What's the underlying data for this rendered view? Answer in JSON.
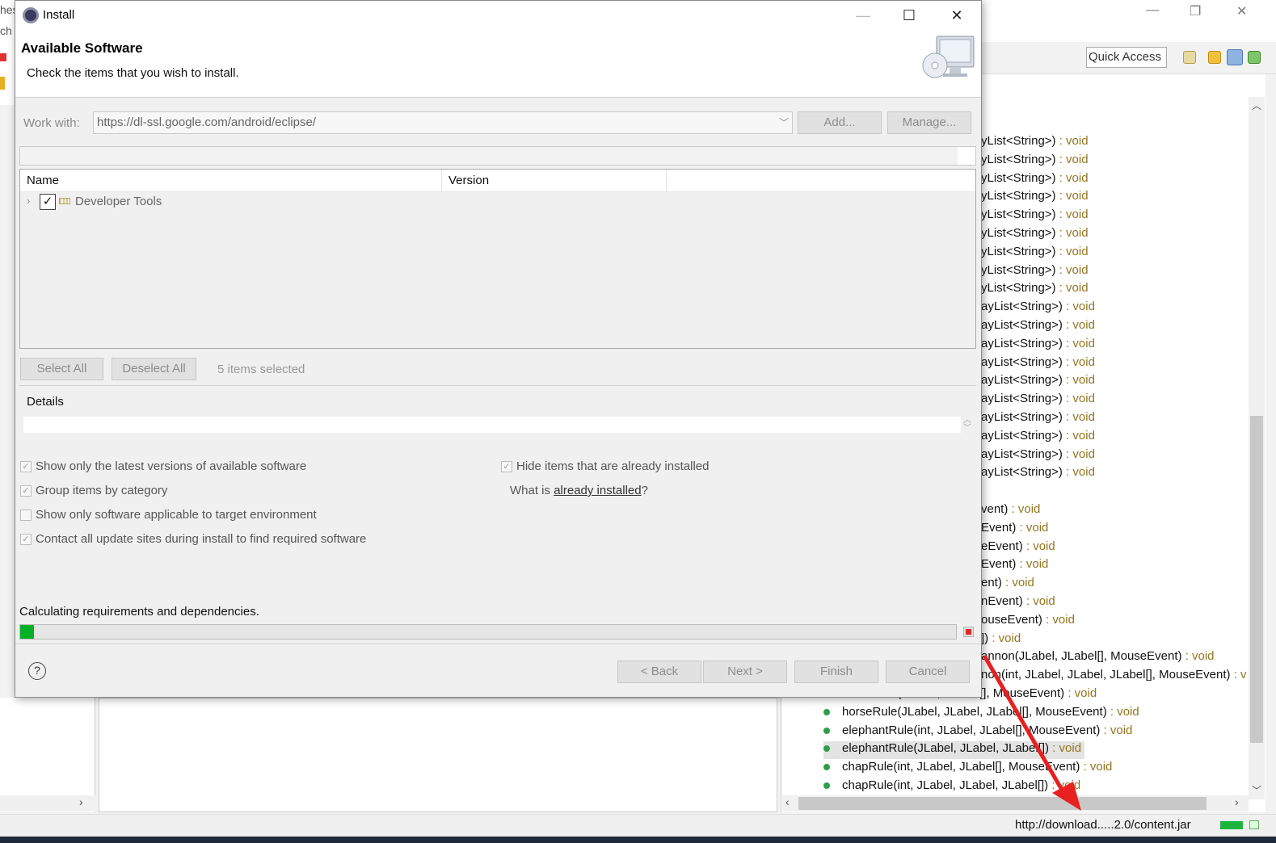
{
  "background": {
    "left_fragments": [
      "hes",
      "ch"
    ],
    "quick_access": "Quick Access",
    "outline_rows": [
      {
        "name": "yList<String>)",
        "ret": " : void"
      },
      {
        "name": "yList<String>)",
        "ret": " : void"
      },
      {
        "name": "yList<String>)",
        "ret": " : void"
      },
      {
        "name": "yList<String>)",
        "ret": " : void"
      },
      {
        "name": "yList<String>)",
        "ret": " : void"
      },
      {
        "name": "yList<String>)",
        "ret": " : void"
      },
      {
        "name": "yList<String>)",
        "ret": " : void"
      },
      {
        "name": "yList<String>)",
        "ret": " : void"
      },
      {
        "name": "yList<String>)",
        "ret": " : void"
      },
      {
        "name": "ayList<String>)",
        "ret": " : void"
      },
      {
        "name": "ayList<String>)",
        "ret": " : void"
      },
      {
        "name": "ayList<String>)",
        "ret": " : void"
      },
      {
        "name": "ayList<String>)",
        "ret": " : void"
      },
      {
        "name": "ayList<String>)",
        "ret": " : void"
      },
      {
        "name": "ayList<String>)",
        "ret": " : void"
      },
      {
        "name": "ayList<String>)",
        "ret": " : void"
      },
      {
        "name": "ayList<String>)",
        "ret": " : void"
      },
      {
        "name": "ayList<String>)",
        "ret": " : void"
      },
      {
        "name": "ayList<String>)",
        "ret": " : void"
      },
      {
        "name": "",
        "ret": ""
      },
      {
        "name": "vent)",
        "ret": " : void"
      },
      {
        "name": "Event)",
        "ret": " : void"
      },
      {
        "name": "eEvent)",
        "ret": " : void"
      },
      {
        "name": "Event)",
        "ret": " : void"
      },
      {
        "name": "ent)",
        "ret": " : void"
      },
      {
        "name": "nEvent)",
        "ret": " : void"
      },
      {
        "name": "ouseEvent)",
        "ret": " : void"
      },
      {
        "name": "])",
        "ret": " : void"
      },
      {
        "name": "annon(JLabel, JLabel[], MouseEvent)",
        "ret": " : void"
      },
      {
        "name": "non(int, JLabel, JLabel, JLabel[], MouseEvent)",
        "ret": " : v"
      },
      {
        "name": "horseRule(JLabel, JLabel[], MouseEvent)",
        "ret": " : void"
      },
      {
        "name": "horseRule(JLabel, JLabel, JLabel[], MouseEvent)",
        "ret": " : void"
      },
      {
        "name": "elephantRule(int, JLabel, JLabel[], MouseEvent)",
        "ret": " : void"
      },
      {
        "name": "elephantRule(JLabel, JLabel, JLabel[])",
        "ret": " : void"
      },
      {
        "name": "chapRule(int, JLabel, JLabel[], MouseEvent)",
        "ret": " : void"
      },
      {
        "name": "chapRule(int, JLabel, JLabel, JLabel[])",
        "ret": " : void"
      }
    ],
    "status_url": "http://download.....2.0/content.jar"
  },
  "dialog": {
    "title": "Install",
    "header_title": "Available Software",
    "header_desc": "Check the items that you wish to install.",
    "work_with_label": "Work with:",
    "work_with_value": "https://dl-ssl.google.com/android/eclipse/",
    "add_button": "Add...",
    "manage_button": "Manage...",
    "columns": [
      "Name",
      "Version"
    ],
    "tree_item": {
      "label": "Developer Tools",
      "checked": true
    },
    "select_all": "Select All",
    "deselect_all": "Deselect All",
    "selection_count": "5 items selected",
    "details_label": "Details",
    "options": {
      "latest_versions": {
        "label": "Show only the latest versions of available software",
        "checked": true
      },
      "group_by_category": {
        "label": "Group items by category",
        "checked": true
      },
      "target_env": {
        "label": "Show only software applicable to target environment",
        "checked": false
      },
      "contact_sites": {
        "label": "Contact all update sites during install to find required software",
        "checked": true
      },
      "hide_installed": {
        "label": "Hide items that are already installed",
        "checked": true
      }
    },
    "already_prefix": "What is ",
    "already_link": "already installed",
    "already_suffix": "?",
    "status_text": "Calculating requirements and dependencies.",
    "progress_fraction": 0.015,
    "buttons": {
      "back": "< Back",
      "next": "Next >",
      "finish": "Finish",
      "cancel": "Cancel"
    },
    "help_glyph": "?"
  },
  "colors": {
    "accent_green": "#06b025",
    "return_type": "#95741e",
    "arrow_red": "#e82020"
  }
}
